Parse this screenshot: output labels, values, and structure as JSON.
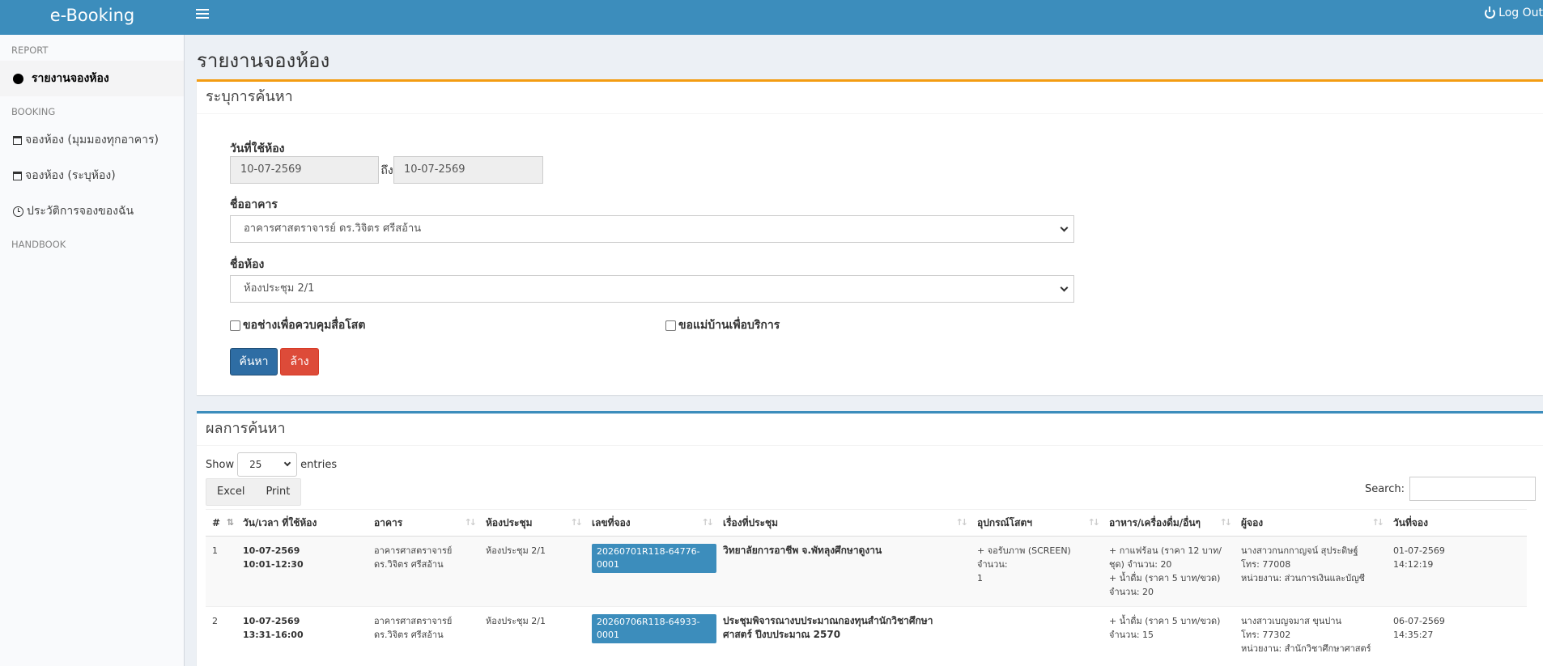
{
  "app": {
    "title": "e-Booking",
    "logout_label": "Log Out"
  },
  "sidebar": {
    "sections": [
      {
        "header": "REPORT",
        "items": [
          {
            "label": "รายงานจองห้อง",
            "icon": "circle-icon",
            "active": true
          }
        ]
      },
      {
        "header": "BOOKING",
        "items": [
          {
            "label": "จองห้อง (มุมมองทุกอาคาร)",
            "icon": "calendar-icon"
          },
          {
            "label": "จองห้อง (ระบุห้อง)",
            "icon": "calendar-icon"
          },
          {
            "label": "ประวัติการจองของฉัน",
            "icon": "clock-icon"
          }
        ]
      },
      {
        "header": "HANDBOOK",
        "items": []
      }
    ]
  },
  "page": {
    "title": "รายงานจองห้อง"
  },
  "search": {
    "box_title": "ระบุการค้นหา",
    "date_label": "วันที่ใช้ห้อง",
    "date_from": "10-07-2569",
    "to_label": "ถึง",
    "date_to": "10-07-2569",
    "building_label": "ชื่ออาคาร",
    "building_value": "อาคารศาสตราจารย์ ดร.วิจิตร ศรีสอ้าน",
    "room_label": "ชื่อห้อง",
    "room_value": "ห้องประชุม 2/1",
    "checkbox_tech": "ขอช่างเพื่อควบคุมสื่อโสต",
    "checkbox_maid": "ขอแม่บ้านเพื่อบริการ",
    "search_button": "ค้นหา",
    "clear_button": "ล้าง"
  },
  "results": {
    "box_title": "ผลการค้นหา",
    "show_label": "Show",
    "page_length": "25",
    "entries_label": "entries",
    "excel_label": "Excel",
    "print_label": "Print",
    "search_label": "Search:",
    "columns": [
      "#",
      "วัน/เวลา ที่ใช้ห้อง",
      "อาคาร",
      "ห้องประชุม",
      "เลขที่จอง",
      "เรื่องที่ประชุม",
      "อุปกรณ์โสตฯ",
      "อาหาร/เครื่องดื่ม/อื่นๆ",
      "ผู้จอง",
      "วันที่จอง"
    ],
    "rows": [
      {
        "num": "1",
        "date": "10-07-2569",
        "time": "10:01-12:30",
        "building_1": "อาคารศาสตราจารย์",
        "building_2": "ดร.วิจิตร ศรีสอ้าน",
        "room": "ห้องประชุม 2/1",
        "booking_no": "20260701R118-64776-0001",
        "subject_1": "วิทยาลัยการอาชีพ จ.พัทลุงศึกษาดูงาน",
        "subject_2": "",
        "av_1": "+ จอรับภาพ (SCREEN) จำนวน:",
        "av_2": "1",
        "food_1": "+ กาแฟร้อน (ราคา 12 บาท/",
        "food_2": "ชุด) จำนวน: 20",
        "food_3": "+ น้ำดื่ม (ราคา 5 บาท/ขวด)",
        "food_4": "จำนวน: 20",
        "booker_1": "นางสาวกนกกาญจน์ สุประดิษฐ์",
        "booker_2": "โทร: 77008",
        "booker_3": "หน่วยงาน: ส่วนการเงินและบัญชี",
        "booked_date": "01-07-2569",
        "booked_time": "14:12:19"
      },
      {
        "num": "2",
        "date": "10-07-2569",
        "time": "13:31-16:00",
        "building_1": "อาคารศาสตราจารย์",
        "building_2": "ดร.วิจิตร ศรีสอ้าน",
        "room": "ห้องประชุม 2/1",
        "booking_no": "20260706R118-64933-0001",
        "subject_1": "ประชุมพิจารณางบประมาณกองทุนสำนักวิชาศึกษา",
        "subject_2": "ศาสตร์ ปีงบประมาณ 2570",
        "av_1": "",
        "av_2": "",
        "food_1": "+ น้ำดื่ม (ราคา 5 บาท/ขวด)",
        "food_2": "จำนวน: 15",
        "food_3": "",
        "food_4": "",
        "booker_1": "นางสาวเบญจมาส ขุนปาน",
        "booker_2": "โทร: 77302",
        "booker_3": "หน่วยงาน: สำนักวิชาศึกษาศาสตร์",
        "booked_date": "06-07-2569",
        "booked_time": "14:35:27"
      }
    ]
  },
  "colors": {
    "header": "#3c8dbc",
    "warning_border": "#f39c12",
    "primary_button": "#2e6da4",
    "danger_button": "#dd4b39",
    "badge": "#3c8dbc"
  }
}
